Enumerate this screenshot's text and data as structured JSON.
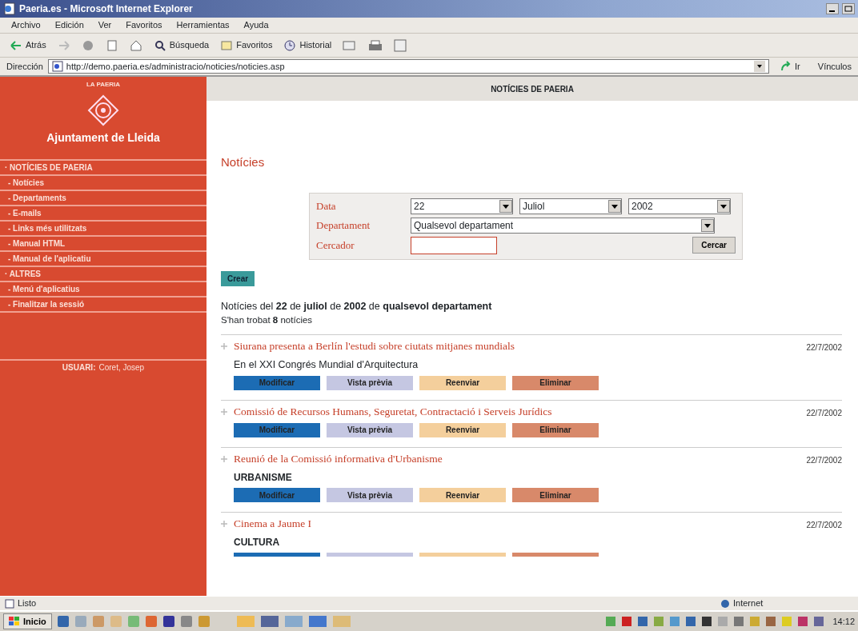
{
  "window": {
    "title": "Paeria.es - Microsoft Internet Explorer"
  },
  "menu": [
    "Archivo",
    "Edición",
    "Ver",
    "Favoritos",
    "Herramientas",
    "Ayuda"
  ],
  "toolbar": [
    {
      "kind": "back",
      "label": "Atrás"
    },
    {
      "kind": "search",
      "label": "Búsqueda"
    },
    {
      "kind": "favorites",
      "label": "Favoritos"
    },
    {
      "kind": "history",
      "label": "Historial"
    }
  ],
  "address": {
    "label": "Dirección",
    "url": "http://demo.paeria.es/administracio/noticies/noticies.asp",
    "go": "Ir",
    "links": "Vínculos"
  },
  "sidebar": {
    "org": "LA PAERIA",
    "title": "Ajuntament de Lleida",
    "items": [
      {
        "label": "· NOTÍCIES DE PAERIA",
        "children": [
          {
            "label": "- Notícies"
          },
          {
            "label": "- Departaments"
          },
          {
            "label": "- E-mails"
          },
          {
            "label": "- Links més utilitzats"
          },
          {
            "label": "- Manual HTML"
          },
          {
            "label": "- Manual de l'aplicatiu"
          }
        ]
      },
      {
        "label": "· ALTRES",
        "children": [
          {
            "label": "- Menú d'aplicatius"
          },
          {
            "label": "- Finalitzar la sessió"
          }
        ]
      }
    ],
    "user_label": "USUARI:",
    "user": "Coret, Josep"
  },
  "header": "NOTÍCIES DE PAERIA",
  "page_title": "Notícies",
  "filter": {
    "date_label": "Data",
    "day": "22",
    "month": "Juliol",
    "year": "2002",
    "department_label": "Departament",
    "department": "Qualsevol departament",
    "search_label": "Cercador",
    "search_button": "Cercar"
  },
  "create_button": "Crear",
  "summary": "Notícies del **22** de **juliol** de **2002** de **qualsevol departament**",
  "count": "S'han trobat **8** notícies",
  "news": [
    {
      "title": "Siurana presenta a Berlín l'estudi sobre ciutats mitjanes mundials",
      "date": "22/7/2002",
      "subtitle": {
        "kind": "text",
        "text": "En el XXI Congrés Mundial d'Arquitectura"
      },
      "buttons_visible": true,
      "buttons": [
        {
          "label": "Modificar",
          "color": "#1c6cb4"
        },
        {
          "label": "Vista prèvia",
          "color": "#c5c7e2"
        },
        {
          "label": "Reenviar",
          "color": "#f4cf9c"
        },
        {
          "label": "Eliminar",
          "color": "#d8896a"
        }
      ]
    },
    {
      "title": "Comissió de Recursos Humans, Seguretat, Contractació i Serveis Jurídics",
      "date": "22/7/2002",
      "buttons_visible": true,
      "buttons": [
        {
          "label": "Modificar",
          "color": "#1c6cb4"
        },
        {
          "label": "Vista prèvia",
          "color": "#c5c7e2"
        },
        {
          "label": "Reenviar",
          "color": "#f4cf9c"
        },
        {
          "label": "Eliminar",
          "color": "#d8896a"
        }
      ]
    },
    {
      "title": "Reunió de la Comissió informativa d'Urbanisme",
      "date": "22/7/2002",
      "subtitle": {
        "kind": "category",
        "text": "URBANISME"
      },
      "buttons_visible": true,
      "buttons": [
        {
          "label": "Modificar",
          "color": "#1c6cb4"
        },
        {
          "label": "Vista prèvia",
          "color": "#c5c7e2"
        },
        {
          "label": "Reenviar",
          "color": "#f4cf9c"
        },
        {
          "label": "Eliminar",
          "color": "#d8896a"
        }
      ]
    },
    {
      "title": "Cinema a Jaume I",
      "date": "22/7/2002",
      "subtitle": {
        "kind": "category",
        "text": "CULTURA"
      },
      "buttons_visible": false,
      "buttons": [
        {
          "color": "#1c6cb4"
        },
        {
          "color": "#c5c7e2"
        },
        {
          "color": "#f4cf9c"
        },
        {
          "color": "#d8896a"
        }
      ]
    }
  ],
  "status_bar": {
    "text": "Listo",
    "zone": "Internet"
  },
  "taskbar": {
    "start": "Inicio",
    "clock": "14:12"
  }
}
